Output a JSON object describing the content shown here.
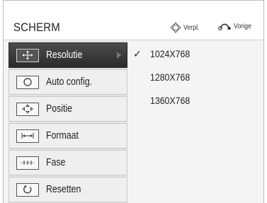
{
  "header": {
    "title": "SCHERM",
    "hints": [
      {
        "icon": "move-arrows-icon",
        "label": "Verpl."
      },
      {
        "icon": "back-icon",
        "label": "Vorige"
      }
    ]
  },
  "menu": {
    "items": [
      {
        "label": "Resolutie",
        "icon": "move-arrows-icon",
        "selected": true
      },
      {
        "label": "Auto config.",
        "icon": "auto-config-icon"
      },
      {
        "label": "Positie",
        "icon": "position-icon"
      },
      {
        "label": "Formaat",
        "icon": "size-icon"
      },
      {
        "label": "Fase",
        "icon": "phase-icon"
      },
      {
        "label": "Resetten",
        "icon": "reset-icon"
      }
    ]
  },
  "options": {
    "selected_index": 0,
    "check_mark": "✓",
    "items": [
      {
        "label": "1024X768"
      },
      {
        "label": "1280X768"
      },
      {
        "label": "1360X768"
      }
    ]
  }
}
